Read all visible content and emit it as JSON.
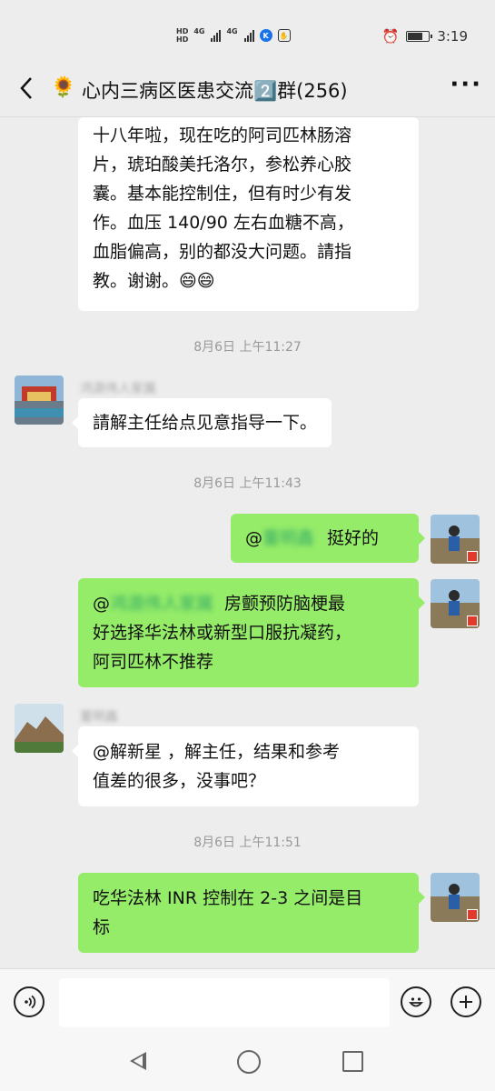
{
  "status_bar": {
    "hd_top": "HD",
    "hd_bottom": "HD",
    "net1": "4G",
    "net2": "4G",
    "app_k": "K",
    "time": "3:19",
    "battery_level": 0.75
  },
  "header": {
    "group_name": "心内三病区医患交流2️⃣群(256)",
    "emoji": "🌻",
    "more": "···"
  },
  "messages": {
    "m1_lines": [
      "十八年啦，现在吃的阿司匹林肠溶",
      "片，琥珀酸美托洛尔，参松养心胶",
      "囊。基本能控制住，但有时少有发",
      "作。血压 140/90 左右血糖不高，",
      "血脂偏高，别的都没大问题。請指",
      "教。谢谢。😄😄"
    ],
    "t1": "8月6日 上午11:27",
    "m2_sender": "鸿源伟人家属",
    "m2_text": "請解主任给点见意指导一下。",
    "t2": "8月6日 上午11:43",
    "m3_mention": "@",
    "m3_mention_name": "董明鑫",
    "m3_text": "挺好的",
    "m4_mention": "@",
    "m4_mention_name": "鸿源伟人家属",
    "m4_line1": "房颤预防脑梗最",
    "m4_line2": "好选择华法林或新型口服抗凝药，",
    "m4_line3": "阿司匹林不推荐",
    "m5_sender": "董明鑫",
    "m5_line1": "@解新星 ，解主任，结果和参考",
    "m5_line2": "值差的很多，没事吧？",
    "t3": "8月6日 上午11:51",
    "m6_line1": "吃华法林 INR 控制在 2-3 之间是目",
    "m6_line2": "标"
  },
  "input": {
    "voice_icon": "voice-icon",
    "emoji_icon": "emoji-icon",
    "plus_icon": "plus-icon"
  }
}
